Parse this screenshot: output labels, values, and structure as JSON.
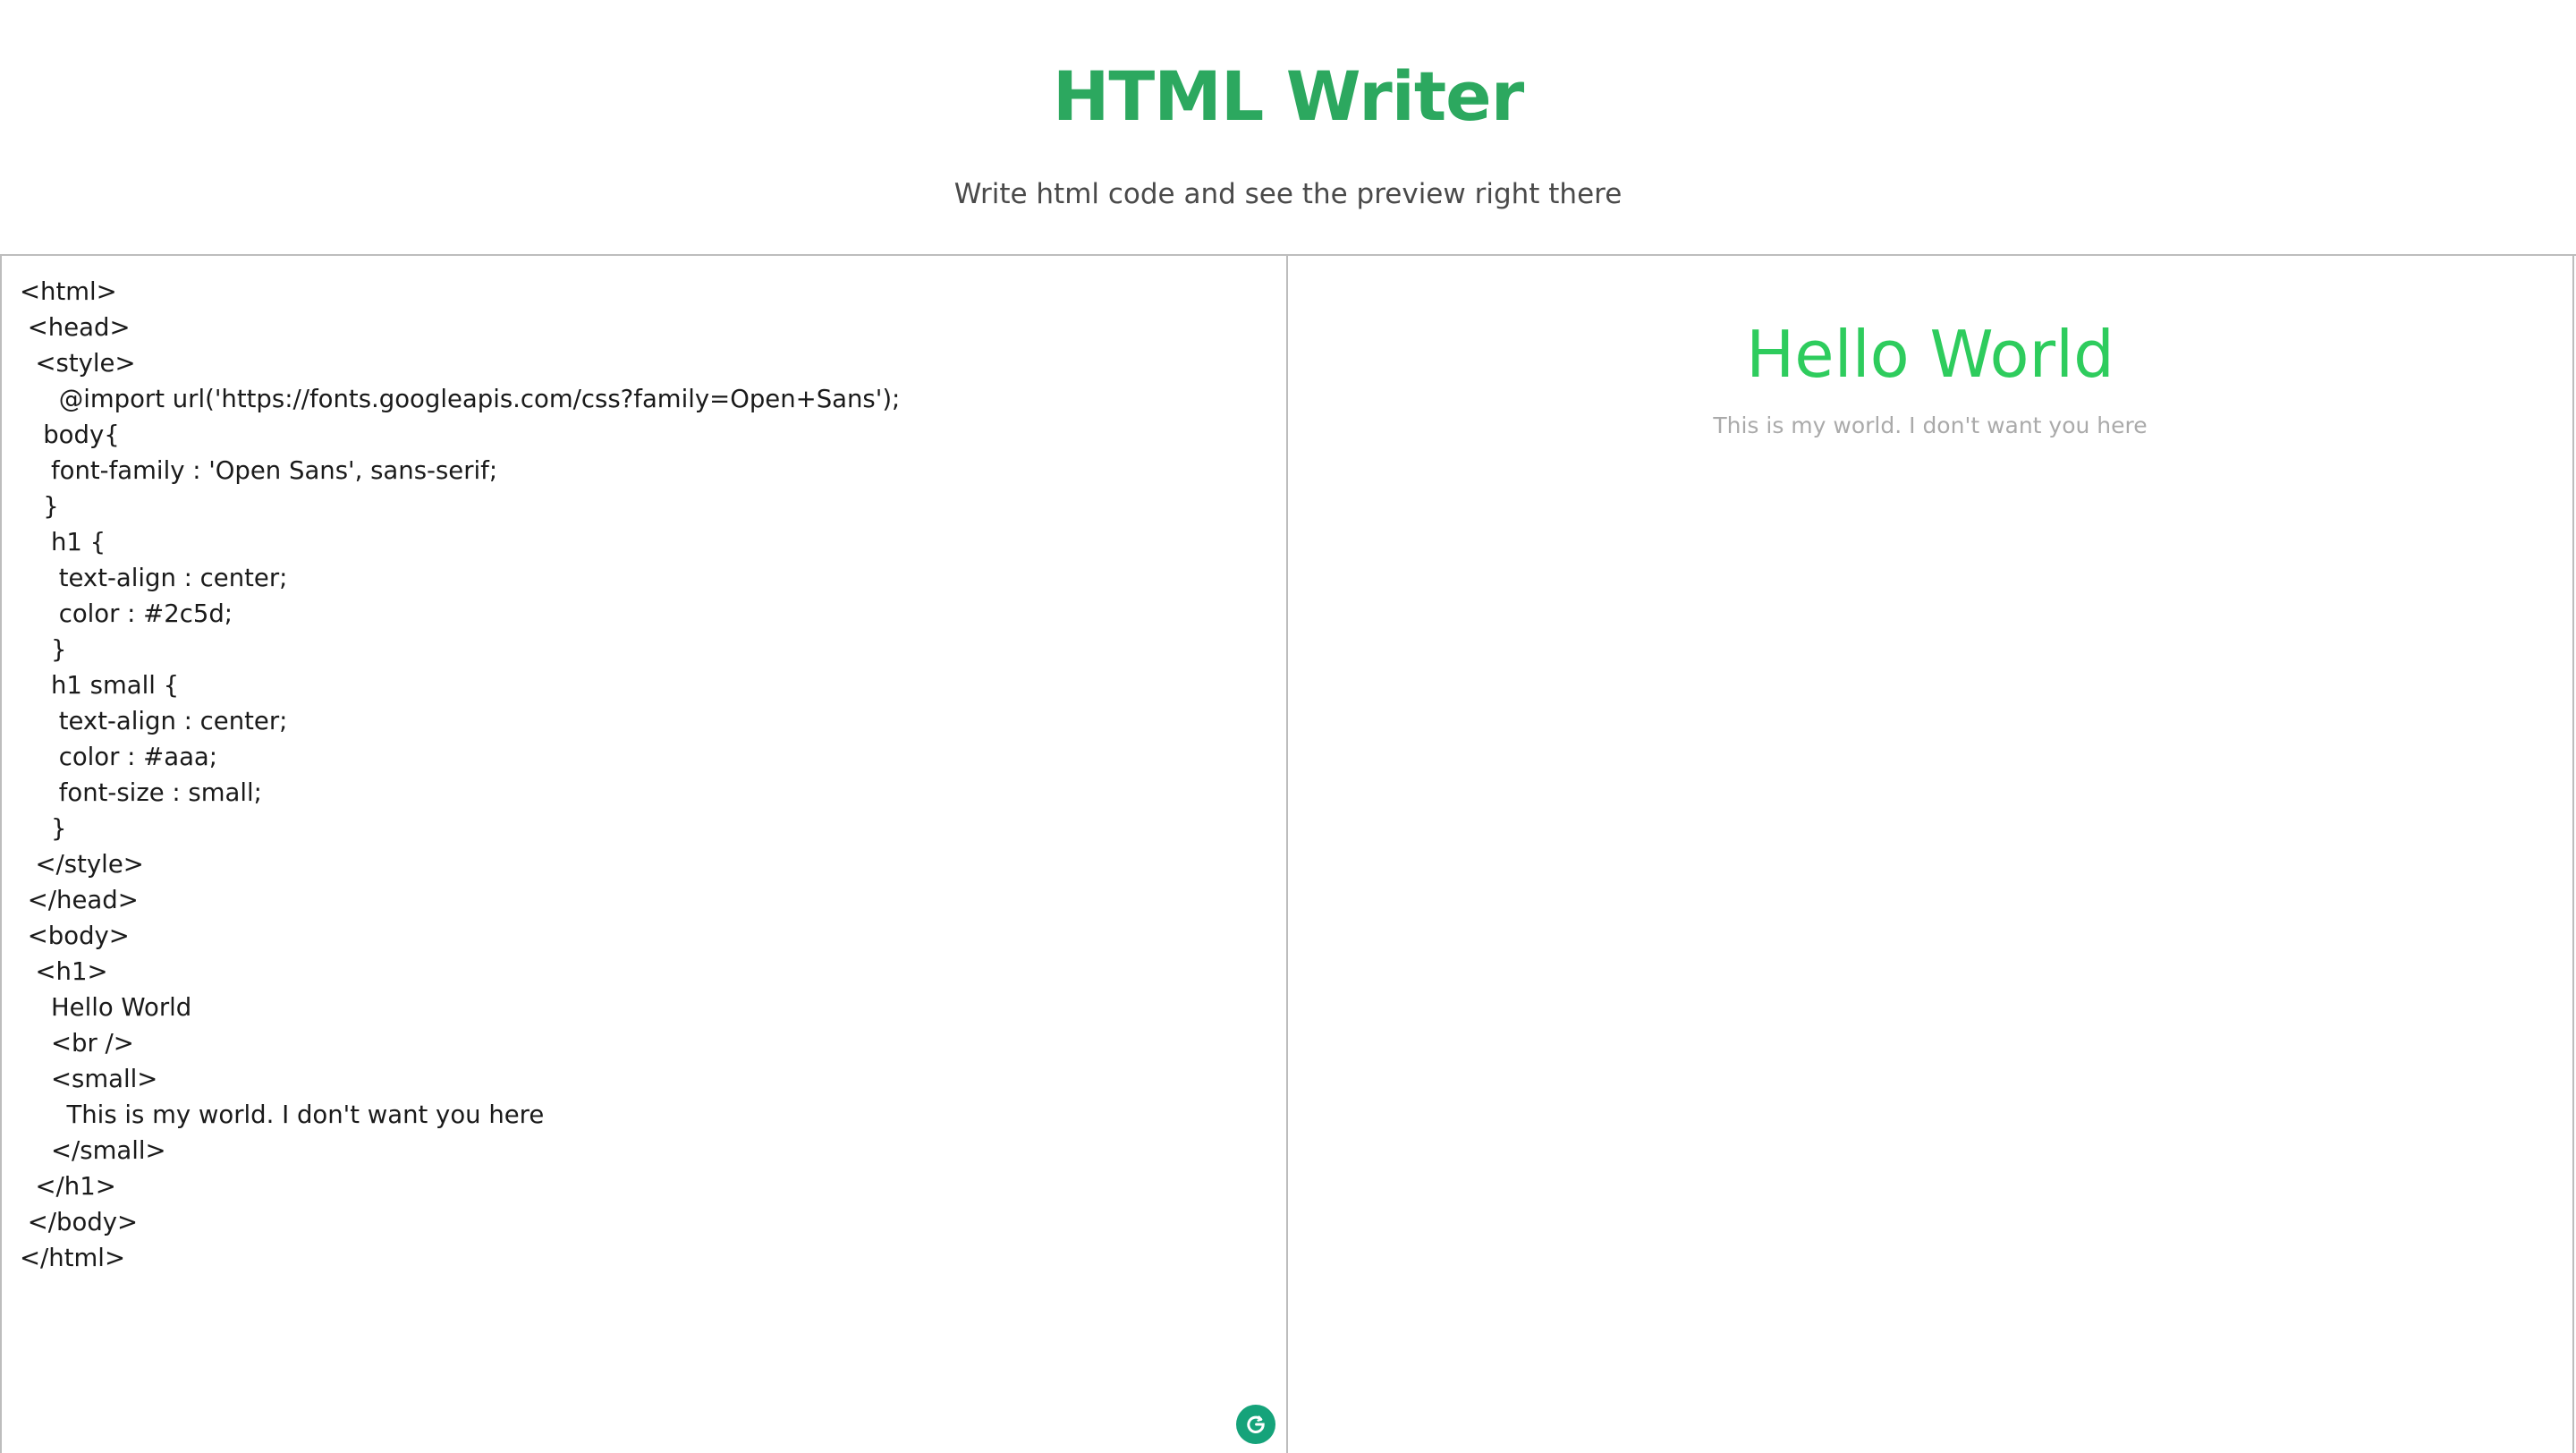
{
  "header": {
    "title": "HTML Writer",
    "subtitle": "Write html code and see the preview right there"
  },
  "editor": {
    "code": "<html>\n <head>\n  <style>\n     @import url('https://fonts.googleapis.com/css?family=Open+Sans');\n   body{\n    font-family : 'Open Sans', sans-serif;\n   }\n    h1 {\n     text-align : center;\n     color : #2c5d;\n    }\n    h1 small {\n     text-align : center;\n     color : #aaa;\n     font-size : small;\n    }\n  </style>\n </head>\n <body>\n  <h1>\n    Hello World\n    <br />\n    <small>\n      This is my world. I don't want you here\n    </small>\n  </h1>\n </body>\n</html>",
    "assistant_icon": "grammarly-icon"
  },
  "preview": {
    "heading": "Hello World",
    "small": "This is my world. I don't want you here"
  },
  "colors": {
    "brand": "#2ca85f",
    "preview_heading": "#2ecc5d",
    "preview_small": "#aaaaaa",
    "grammarly_badge": "#15a37a"
  }
}
